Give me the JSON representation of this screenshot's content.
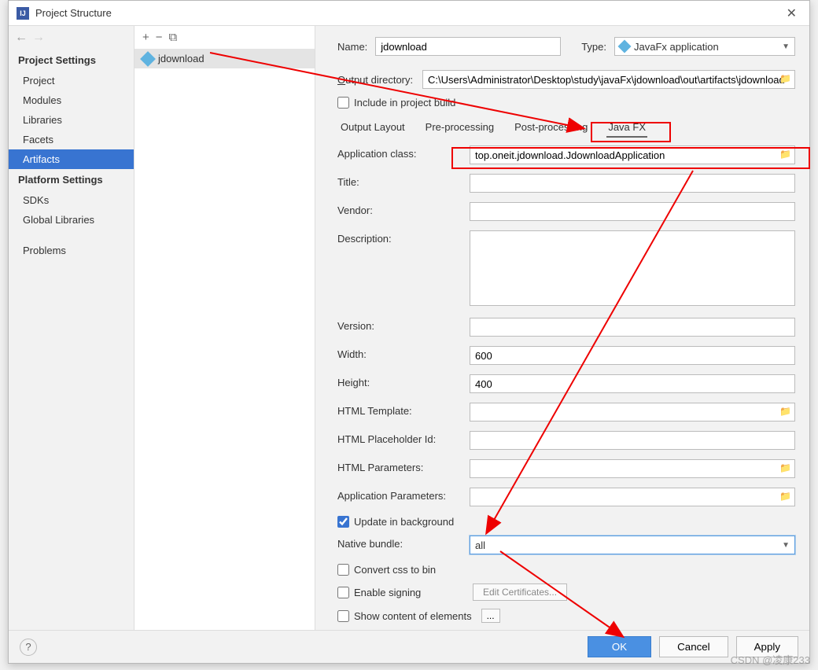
{
  "window": {
    "title": "Project Structure",
    "close": "✕"
  },
  "leftPane": {
    "sections": {
      "projectSettings": "Project Settings",
      "platformSettings": "Platform Settings"
    },
    "items": {
      "project": "Project",
      "modules": "Modules",
      "libraries": "Libraries",
      "facets": "Facets",
      "artifacts": "Artifacts",
      "sdks": "SDKs",
      "globalLibraries": "Global Libraries",
      "problems": "Problems"
    }
  },
  "midPane": {
    "add": "+",
    "remove": "−",
    "copy": "⧉",
    "artifact": "jdownload"
  },
  "rightPane": {
    "nameLabel": "Name:",
    "nameValue": "jdownload",
    "typeLabel": "Type:",
    "typeValue": "JavaFx application",
    "outputDirLabel": "Output directory:",
    "outputDirValue": "C:\\Users\\Administrator\\Desktop\\study\\javaFx\\jdownload\\out\\artifacts\\jdownload",
    "includeLabel": "Include in project build",
    "tabs": {
      "outputLayout": "Output Layout",
      "preProcessing": "Pre-processing",
      "postProcessing": "Post-processing",
      "javaFx": "Java FX"
    },
    "form": {
      "appClassLabel": "Application class:",
      "appClassValue": "top.oneit.jdownload.JdownloadApplication",
      "titleLabel": "Title:",
      "titleValue": "",
      "vendorLabel": "Vendor:",
      "vendorValue": "",
      "descLabel": "Description:",
      "descValue": "",
      "versionLabel": "Version:",
      "versionValue": "",
      "widthLabel": "Width:",
      "widthValue": "600",
      "heightLabel": "Height:",
      "heightValue": "400",
      "htmlTemplateLabel": "HTML Template:",
      "htmlTemplateValue": "",
      "htmlPlaceholderLabel": "HTML Placeholder Id:",
      "htmlPlaceholderValue": "",
      "htmlParamsLabel": "HTML Parameters:",
      "htmlParamsValue": "",
      "appParamsLabel": "Application Parameters:",
      "appParamsValue": "",
      "updateBgLabel": "Update in background",
      "nativeBundleLabel": "Native bundle:",
      "nativeBundleValue": "all",
      "convertCssLabel": "Convert css to bin",
      "enableSigningLabel": "Enable signing",
      "editCertLabel": "Edit Certificates...",
      "showContentLabel": "Show content of elements",
      "dots": "..."
    }
  },
  "footer": {
    "ok": "OK",
    "cancel": "Cancel",
    "apply": "Apply",
    "help": "?"
  },
  "watermark": "CSDN @凌康233"
}
